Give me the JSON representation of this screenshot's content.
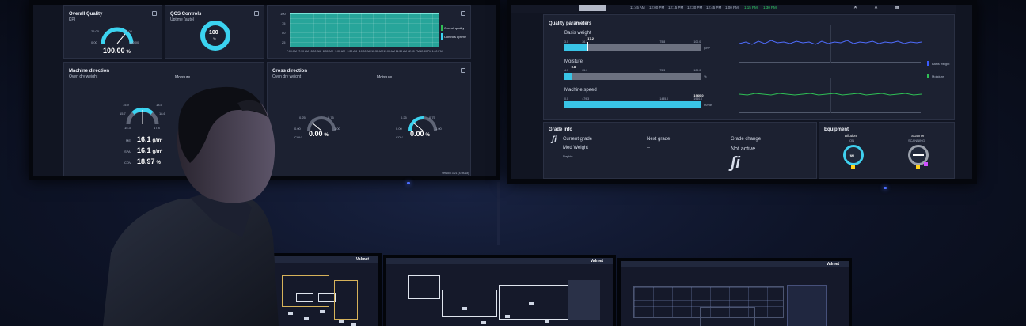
{
  "left_screen": {
    "overall_quality": {
      "title": "Overall Quality",
      "subtitle": "KPI",
      "value": "100.00",
      "unit": "%",
      "min_label": "0.00",
      "max_label": "100.00",
      "low_label": "25.00",
      "high_label": "75.00"
    },
    "qcs_controls": {
      "title": "QCS Controls",
      "subtitle": "Uptime (auto)",
      "value": "100",
      "unit": "%"
    },
    "uptime_trend": {
      "y_ticks": [
        "100",
        "75",
        "50",
        "25"
      ],
      "x_ticks": [
        "7:00 AM",
        "7:30 AM",
        "8:00 AM",
        "8:30 AM",
        "9:00 AM",
        "9:30 AM",
        "10:00 AM",
        "10:30 AM",
        "11:00 AM",
        "11:30 AM",
        "12:00 PM",
        "12:30 PM",
        "1:00 PM"
      ],
      "legend": [
        "Overall quality",
        "Controls uptime"
      ],
      "fill_color": "#27a59a"
    },
    "machine_direction": {
      "title": "Machine direction",
      "subtitle": "Oven dry weight",
      "moisture_label": "Moisture",
      "gauge_labels": [
        "15.9",
        "18.5",
        "15.7",
        "18.6",
        "15.3",
        "17.8"
      ],
      "rows": [
        {
          "label": "ME",
          "value": "16.1",
          "unit": "g/m²"
        },
        {
          "label": "SPA",
          "value": "16.1",
          "unit": "g/m²"
        },
        {
          "label": "COV",
          "value": "18.97",
          "unit": "%"
        }
      ]
    },
    "cross_direction": {
      "title": "Cross direction",
      "subtitle": "Oven dry weight",
      "moisture_label": "Moisture",
      "gauges": [
        {
          "value": "0.00",
          "unit": "%",
          "left": "0.25",
          "right": "0.75",
          "min": "0.00",
          "max": "1.00",
          "caption": "COV"
        },
        {
          "value": "0.00",
          "unit": "%",
          "left": "0.25",
          "right": "0.75",
          "min": "0.00",
          "max": "1.00",
          "caption": "COV"
        }
      ]
    },
    "footer": "Version 3.21 (4.98.18)"
  },
  "right_screen": {
    "timeline": [
      "11:45 AM",
      "12:00 PM",
      "12:15 PM",
      "12:30 PM",
      "12:45 PM",
      "1:00 PM",
      "1:15 PM",
      "1:30 PM"
    ],
    "timeline_highlight_color": "#32d36a",
    "quality_parameters": {
      "title": "Quality parameters",
      "bars": [
        {
          "label": "Basis weight",
          "value": "17.2",
          "scale": [
            "3.0",
            "26.1",
            "75.8",
            "100.0"
          ],
          "unit": "g/m²",
          "fill": 0.17
        },
        {
          "label": "Moisture",
          "value": "5.8",
          "scale": [
            "4.7",
            "25.0",
            "75.3",
            "100.0"
          ],
          "unit": "%",
          "fill": 0.05
        },
        {
          "label": "Machine speed",
          "value": "1960.0",
          "scale": [
            "0.0",
            "479.3",
            "1435.0",
            "1960.0"
          ],
          "unit": "m/min",
          "fill": 1.0
        }
      ],
      "legend": [
        "Basis weight",
        "Moisture"
      ],
      "legend_colors": [
        "#3a5bff",
        "#2fbf55"
      ]
    },
    "grade_info": {
      "title": "Grade info",
      "current_grade_label": "Current grade",
      "current_grade_value": "Med Weight",
      "current_grade_sub": "Napkin",
      "next_grade_label": "Next grade",
      "next_grade_value": "--",
      "grade_change_label": "Grade change",
      "grade_change_value": "Not active",
      "logo_icon": "valmet-si-icon"
    },
    "equipment": {
      "title": "Equipment",
      "items": [
        {
          "label": "Dilution",
          "status": "ON",
          "ring_color": "#3fd0ee",
          "badge_color": "#ffd21a",
          "icon": "dilution-icon"
        },
        {
          "label": "Scanner",
          "status": "SCANNING",
          "ring_color": "#9aa0ab",
          "badge_color": "#ffd21a",
          "badge2_color": "#d04fff",
          "icon": "scanner-icon"
        }
      ]
    }
  },
  "desk_monitors": {
    "brand": "Valmet"
  }
}
